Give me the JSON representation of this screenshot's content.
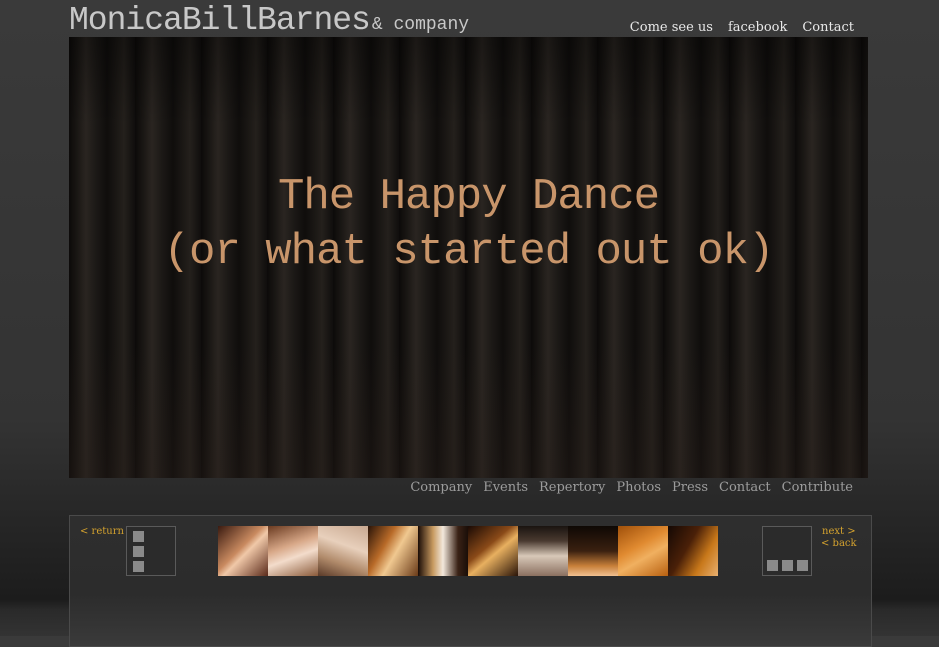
{
  "header": {
    "brand_name": "MonicaBillBarnes",
    "brand_suffix": "& company",
    "nav": [
      "Come see us",
      "facebook",
      "Contact"
    ]
  },
  "stage": {
    "title_line1": "The Happy Dance",
    "title_line2": "(or what started out ok)",
    "title_color": "#c8956a"
  },
  "subnav": [
    "Company",
    "Events",
    "Repertory",
    "Photos",
    "Press",
    "Contact",
    "Contribute"
  ],
  "gallery": {
    "return_label": "< return",
    "next_label": "next >",
    "back_label": "< back",
    "link_color": "#d4a22e",
    "thumbnails": [
      {
        "name": "thumb-1",
        "bg": "linear-gradient(135deg,#3a1a10 0%,#c98a60 45%,#f0c8a8 55%,#5a2a1a 100%)"
      },
      {
        "name": "thumb-2",
        "bg": "linear-gradient(160deg,#6a3a20 0%,#d8a888 40%,#f3dccb 60%,#8a5a3a 100%)"
      },
      {
        "name": "thumb-3",
        "bg": "linear-gradient(200deg,#c8a890 0%,#e8d0bc 40%,#b08a6a 70%,#5a3a28 100%)"
      },
      {
        "name": "thumb-4",
        "bg": "linear-gradient(120deg,#2a1408 0%,#b86a28 35%,#f0c890 55%,#6a3a18 100%)"
      },
      {
        "name": "thumb-5",
        "bg": "linear-gradient(90deg,#1a0c06 0%,#c89a60 30%,#f2e8dc 50%,#3a2216 80%,#1a0e08 100%)"
      },
      {
        "name": "thumb-6",
        "bg": "linear-gradient(140deg,#1a0a04 0%,#8a4a18 40%,#e8b060 55%,#2a1408 100%)"
      },
      {
        "name": "thumb-7",
        "bg": "linear-gradient(180deg,#1a1410 0%,#4a3a30 30%,#d8c8b8 60%,#8a7060 100%)"
      },
      {
        "name": "thumb-8",
        "bg": "linear-gradient(180deg,#0e0804 0%,#3a2010 50%,#c8803a 80%,#f0c090 100%)"
      },
      {
        "name": "thumb-9",
        "bg": "linear-gradient(150deg,#a0500a 0%,#e08a30 40%,#f0b060 60%,#b86010 100%)"
      },
      {
        "name": "thumb-10",
        "bg": "linear-gradient(120deg,#140804 0%,#4a2008 40%,#c8781a 70%,#e8b070 100%)"
      }
    ]
  }
}
